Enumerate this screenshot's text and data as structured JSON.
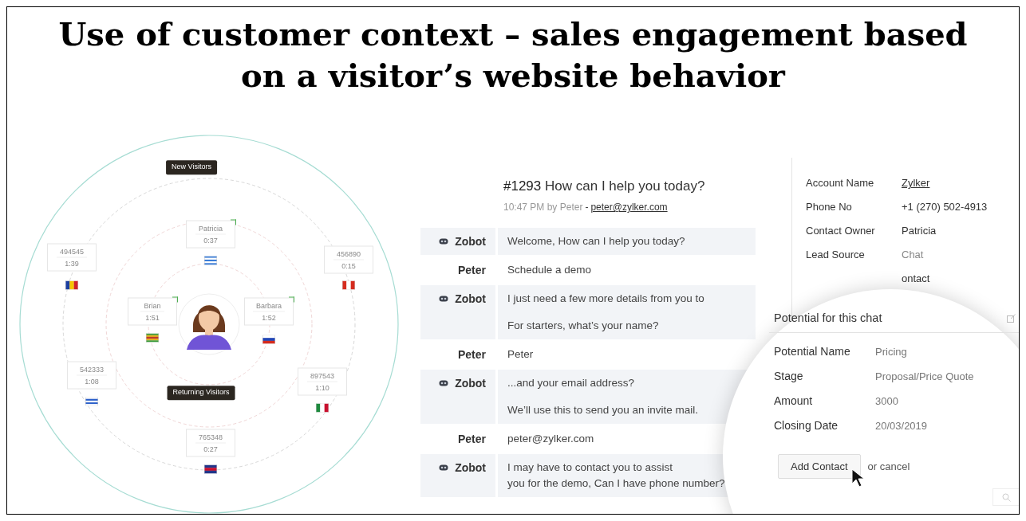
{
  "title": "Use of customer context – sales engagement based on a visitor’s website behavior",
  "radar": {
    "new_label": "New Visitors",
    "returning_label": "Returning Visitors",
    "visitors": [
      {
        "name": "Patricia",
        "time": "0:37",
        "online": true
      },
      {
        "name": "494545",
        "time": "1:39",
        "online": false
      },
      {
        "name": "456890",
        "time": "0:15",
        "online": false
      },
      {
        "name": "Brian",
        "time": "1:51",
        "online": true
      },
      {
        "name": "Barbara",
        "time": "1:52",
        "online": true
      },
      {
        "name": "542333",
        "time": "1:08",
        "online": false
      },
      {
        "name": "897543",
        "time": "1:10",
        "online": false
      },
      {
        "name": "765348",
        "time": "0:27",
        "online": false
      }
    ]
  },
  "chat": {
    "ticket": "#1293",
    "subject": "How can I help you today?",
    "meta": "10:47 PM by Peter",
    "separator": "-",
    "email": "peter@zylker.com",
    "messages": [
      {
        "kind": "bot",
        "sender": "Zobot",
        "paragraphs": [
          "Welcome, How can I help you today?"
        ]
      },
      {
        "kind": "visitor",
        "sender": "Peter",
        "paragraphs": [
          "Schedule a demo"
        ]
      },
      {
        "kind": "bot",
        "sender": "Zobot",
        "paragraphs": [
          "I just need a few more details from you to",
          "For starters, what’s your name?"
        ]
      },
      {
        "kind": "visitor",
        "sender": "Peter",
        "paragraphs": [
          "Peter"
        ]
      },
      {
        "kind": "bot",
        "sender": "Zobot",
        "paragraphs": [
          "...and your email address?",
          "We’ll use this to send you an invite mail."
        ]
      },
      {
        "kind": "visitor",
        "sender": "Peter",
        "paragraphs": [
          "peter@zylker.com"
        ]
      },
      {
        "kind": "bot",
        "sender": "Zobot",
        "paragraphs": [
          "I may have to contact you to assist\nyou for the demo, Can I have phone number?"
        ]
      }
    ]
  },
  "contact": {
    "fields": [
      {
        "label": "Account Name",
        "value": "Zylker",
        "kind": "link"
      },
      {
        "label": "Phone No",
        "value": "+1 (270) 502-4913",
        "kind": "text"
      },
      {
        "label": "Contact Owner",
        "value": "Patricia",
        "kind": "text"
      },
      {
        "label": "Lead Source",
        "value": "Chat",
        "kind": "muted"
      },
      {
        "value": "ontact",
        "kind": "text"
      }
    ]
  },
  "potential": {
    "title": "Potential for this chat",
    "fields": [
      {
        "label": "Potential Name",
        "value": "Pricing"
      },
      {
        "label": "Stage",
        "value": "Proposal/Price Quote"
      },
      {
        "label": "Amount",
        "value": "3000"
      },
      {
        "label": "Closing Date",
        "value": "20/03/2019"
      }
    ],
    "button": "Add Contact",
    "cancel": "or cancel"
  }
}
